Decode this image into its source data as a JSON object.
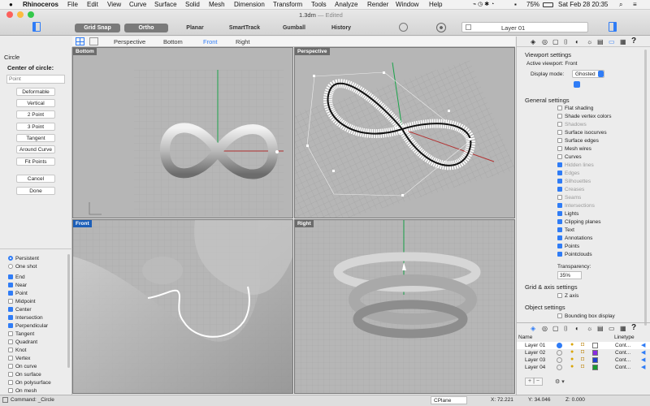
{
  "menubar": {
    "app": "Rhinoceros",
    "items": [
      "File",
      "Edit",
      "View",
      "Curve",
      "Surface",
      "Solid",
      "Mesh",
      "Dimension",
      "Transform",
      "Tools",
      "Analyze",
      "Render",
      "Window",
      "Help"
    ],
    "battery": "75%",
    "clock": "Sat Feb 28  20:35"
  },
  "window": {
    "title": "1.3dm",
    "edited": "— Edited"
  },
  "toolbar": {
    "grid_snap": "Grid Snap",
    "ortho": "Ortho",
    "planar": "Planar",
    "smarttrack": "SmartTrack",
    "gumball": "Gumball",
    "history": "History",
    "layer": "Layer 01"
  },
  "viewport_tabs": [
    "Perspective",
    "Bottom",
    "Front",
    "Right"
  ],
  "viewports": {
    "top_left": "Bottom",
    "top_right": "Perspective",
    "bottom_left": "Front",
    "bottom_right": "Right"
  },
  "command_panel": {
    "title": "Circle",
    "prompt": "Center of circle:",
    "input_placeholder": "Point",
    "options": [
      "Deformable",
      "Vertical",
      "2 Point",
      "3 Point",
      "Tangent",
      "Around Curve",
      "Fit Points"
    ],
    "cancel": "Cancel",
    "done": "Done"
  },
  "osnap": {
    "persistent": "Persistent",
    "one_shot": "One shot",
    "items": [
      {
        "label": "End",
        "checked": true
      },
      {
        "label": "Near",
        "checked": true
      },
      {
        "label": "Point",
        "checked": true
      },
      {
        "label": "Midpoint",
        "checked": false
      },
      {
        "label": "Center",
        "checked": true
      },
      {
        "label": "Intersection",
        "checked": true
      },
      {
        "label": "Perpendicular",
        "checked": true
      },
      {
        "label": "Tangent",
        "checked": false
      },
      {
        "label": "Quadrant",
        "checked": false
      },
      {
        "label": "Knot",
        "checked": false
      },
      {
        "label": "Vertex",
        "checked": false
      },
      {
        "label": "On curve",
        "checked": false
      },
      {
        "label": "On surface",
        "checked": false
      },
      {
        "label": "On polysurface",
        "checked": false
      },
      {
        "label": "On mesh",
        "checked": false
      }
    ]
  },
  "viewport_settings": {
    "title": "Viewport settings",
    "active_viewport": "Active viewport:  Front",
    "display_mode_label": "Display mode:",
    "display_mode": "Ghosted",
    "general_title": "General settings",
    "items": [
      {
        "label": "Flat shading",
        "checked": false,
        "dim": false
      },
      {
        "label": "Shade vertex colors",
        "checked": false,
        "dim": false
      },
      {
        "label": "Shadows",
        "checked": false,
        "dim": true
      },
      {
        "label": "Surface isocurves",
        "checked": false,
        "dim": false
      },
      {
        "label": "Surface edges",
        "checked": false,
        "dim": false
      },
      {
        "label": "Mesh wires",
        "checked": false,
        "dim": false
      },
      {
        "label": "Curves",
        "checked": false,
        "dim": false
      },
      {
        "label": "Hidden lines",
        "checked": true,
        "dim": true
      },
      {
        "label": "Edges",
        "checked": true,
        "dim": true
      },
      {
        "label": "Silhouettes",
        "checked": true,
        "dim": true
      },
      {
        "label": "Creases",
        "checked": true,
        "dim": true
      },
      {
        "label": "Seams",
        "checked": false,
        "dim": true
      },
      {
        "label": "Intersections",
        "checked": true,
        "dim": true
      },
      {
        "label": "Lights",
        "checked": true,
        "dim": false
      },
      {
        "label": "Clipping planes",
        "checked": true,
        "dim": false
      },
      {
        "label": "Text",
        "checked": true,
        "dim": false
      },
      {
        "label": "Annotations",
        "checked": true,
        "dim": false
      },
      {
        "label": "Points",
        "checked": true,
        "dim": false
      },
      {
        "label": "Pointclouds",
        "checked": true,
        "dim": false
      }
    ],
    "transparency_label": "Transparency:",
    "transparency": "35%",
    "grid_title": "Grid & axis settings",
    "z_axis": "Z axis",
    "object_title": "Object settings",
    "bounding_box": "Bounding box display"
  },
  "layers": {
    "name_col": "Name",
    "linetype_col": "Linetype",
    "rows": [
      {
        "name": "Layer 01",
        "linetype": "Cont...",
        "color": "#ffffff"
      },
      {
        "name": "Layer 02",
        "linetype": "Cont...",
        "color": "#8a2be2"
      },
      {
        "name": "Layer 03",
        "linetype": "Cont...",
        "color": "#2040d0"
      },
      {
        "name": "Layer 04",
        "linetype": "Cont...",
        "color": "#1a9a30"
      }
    ]
  },
  "status": {
    "command": "Command: _Circle",
    "cplane": "CPlane",
    "x": "X: 72.221",
    "y": "Y: 34.046",
    "z": "Z: 0.000"
  }
}
